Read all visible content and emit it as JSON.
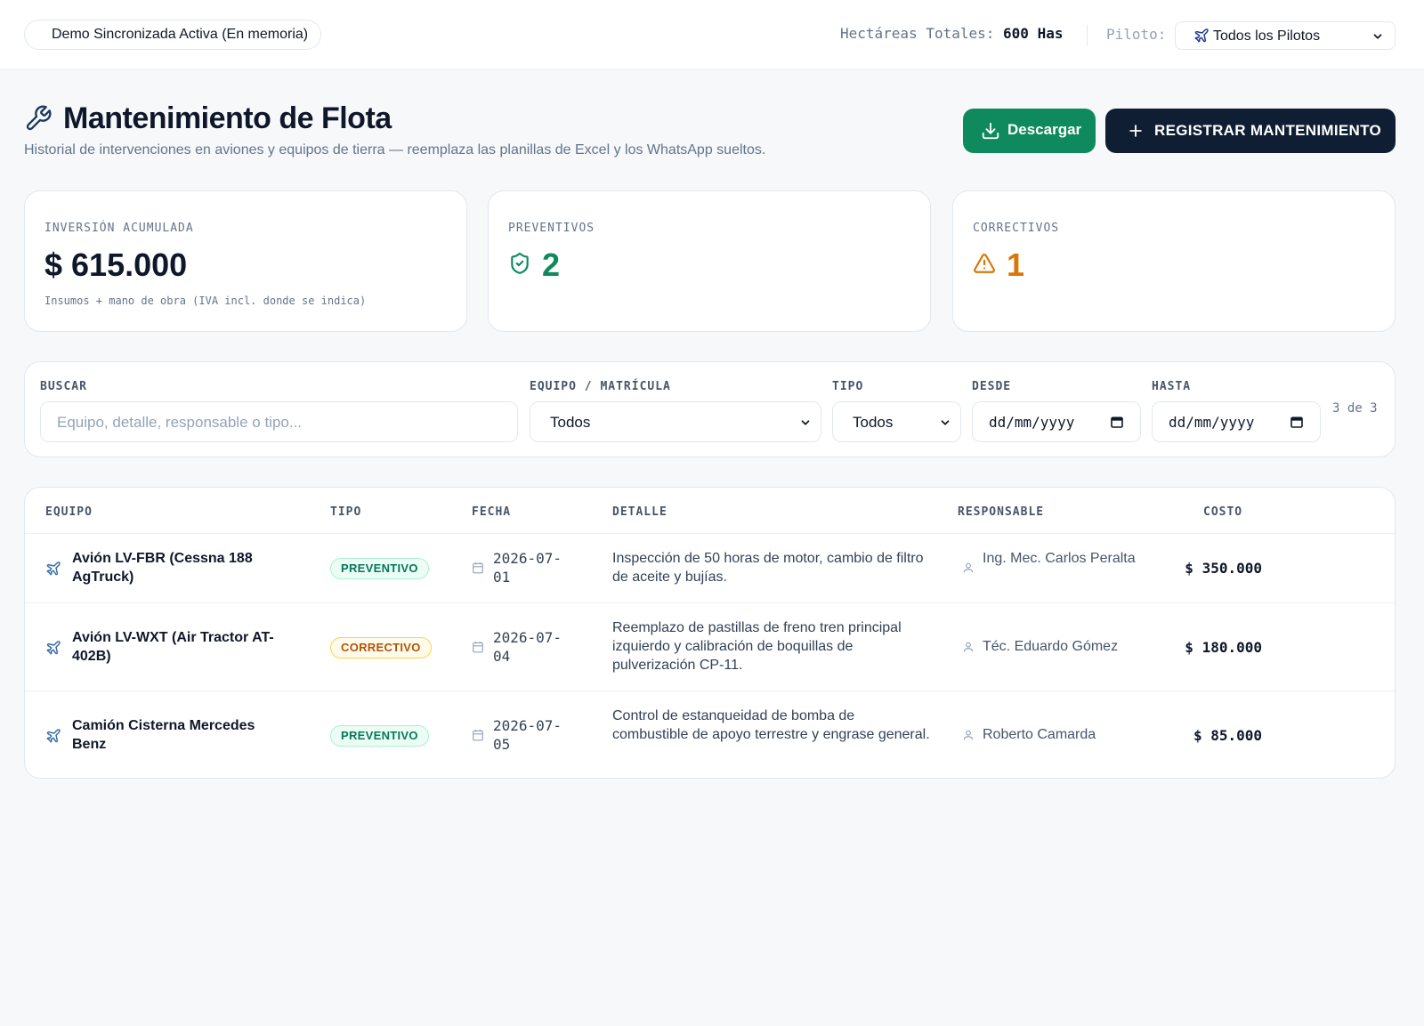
{
  "topbar": {
    "demo_badge": "Demo Sincronizada Activa (En memoria)",
    "hectareas_label": "Hectáreas Totales:",
    "hectareas_value": "600 Has",
    "piloto_label": "Piloto:",
    "piloto_selected": "Todos los Pilotos"
  },
  "header": {
    "title": "Mantenimiento de Flota",
    "subtitle": "Historial de intervenciones en aviones y equipos de tierra — reemplaza las planillas de Excel y los WhatsApp sueltos.",
    "download_label": "Descargar",
    "register_label": "REGISTRAR MANTENIMIENTO"
  },
  "kpis": {
    "inversion": {
      "label": "INVERSIÓN ACUMULADA",
      "value": "$ 615.000",
      "note": "Insumos + mano de obra (IVA incl. donde se indica)"
    },
    "preventivos": {
      "label": "PREVENTIVOS",
      "value": "2",
      "icon": "shield-check-icon",
      "color": "#0f8a5f"
    },
    "correctivos": {
      "label": "CORRECTIVOS",
      "value": "1",
      "icon": "warning-triangle-icon",
      "color": "#d97706"
    }
  },
  "filters": {
    "buscar_label": "BUSCAR",
    "buscar_placeholder": "Equipo, detalle, responsable o tipo...",
    "equipo_label": "EQUIPO / MATRÍCULA",
    "equipo_value": "Todos",
    "tipo_label": "TIPO",
    "tipo_value": "Todos",
    "desde_label": "DESDE",
    "desde_value": "dd/mm/yyyy",
    "hasta_label": "HASTA",
    "hasta_value": "dd/mm/yyyy",
    "count": "3 de 3"
  },
  "table": {
    "headers": {
      "equipo": "EQUIPO",
      "tipo": "TIPO",
      "fecha": "FECHA",
      "detalle": "DETALLE",
      "responsable": "RESPONSABLE",
      "costo": "COSTO"
    },
    "rows": [
      {
        "equipo": "Avión LV-FBR (Cessna 188 AgTruck)",
        "tipo": "PREVENTIVO",
        "fecha": "2026-07-01",
        "detalle": "Inspección de 50 horas de motor, cambio de filtro de aceite y bujías.",
        "responsable": "Ing. Mec. Carlos Peralta",
        "costo": "$ 350.000"
      },
      {
        "equipo": "Avión LV-WXT (Air Tractor AT-402B)",
        "tipo": "CORRECTIVO",
        "fecha": "2026-07-04",
        "detalle": "Reemplazo de pastillas de freno tren principal izquierdo y calibración de boquillas de pulverización CP-11.",
        "responsable": "Téc. Eduardo Gómez",
        "costo": "$ 180.000"
      },
      {
        "equipo": "Camión Cisterna Mercedes Benz",
        "tipo": "PREVENTIVO",
        "fecha": "2026-07-05",
        "detalle": "Control de estanqueidad de bomba de combustible de apoyo terrestre y engrase general.",
        "responsable": "Roberto Camarda",
        "costo": "$ 85.000"
      }
    ]
  },
  "colors": {
    "accent_green": "#0f8a5f",
    "navy": "#0f1e33",
    "warning": "#d97706"
  }
}
